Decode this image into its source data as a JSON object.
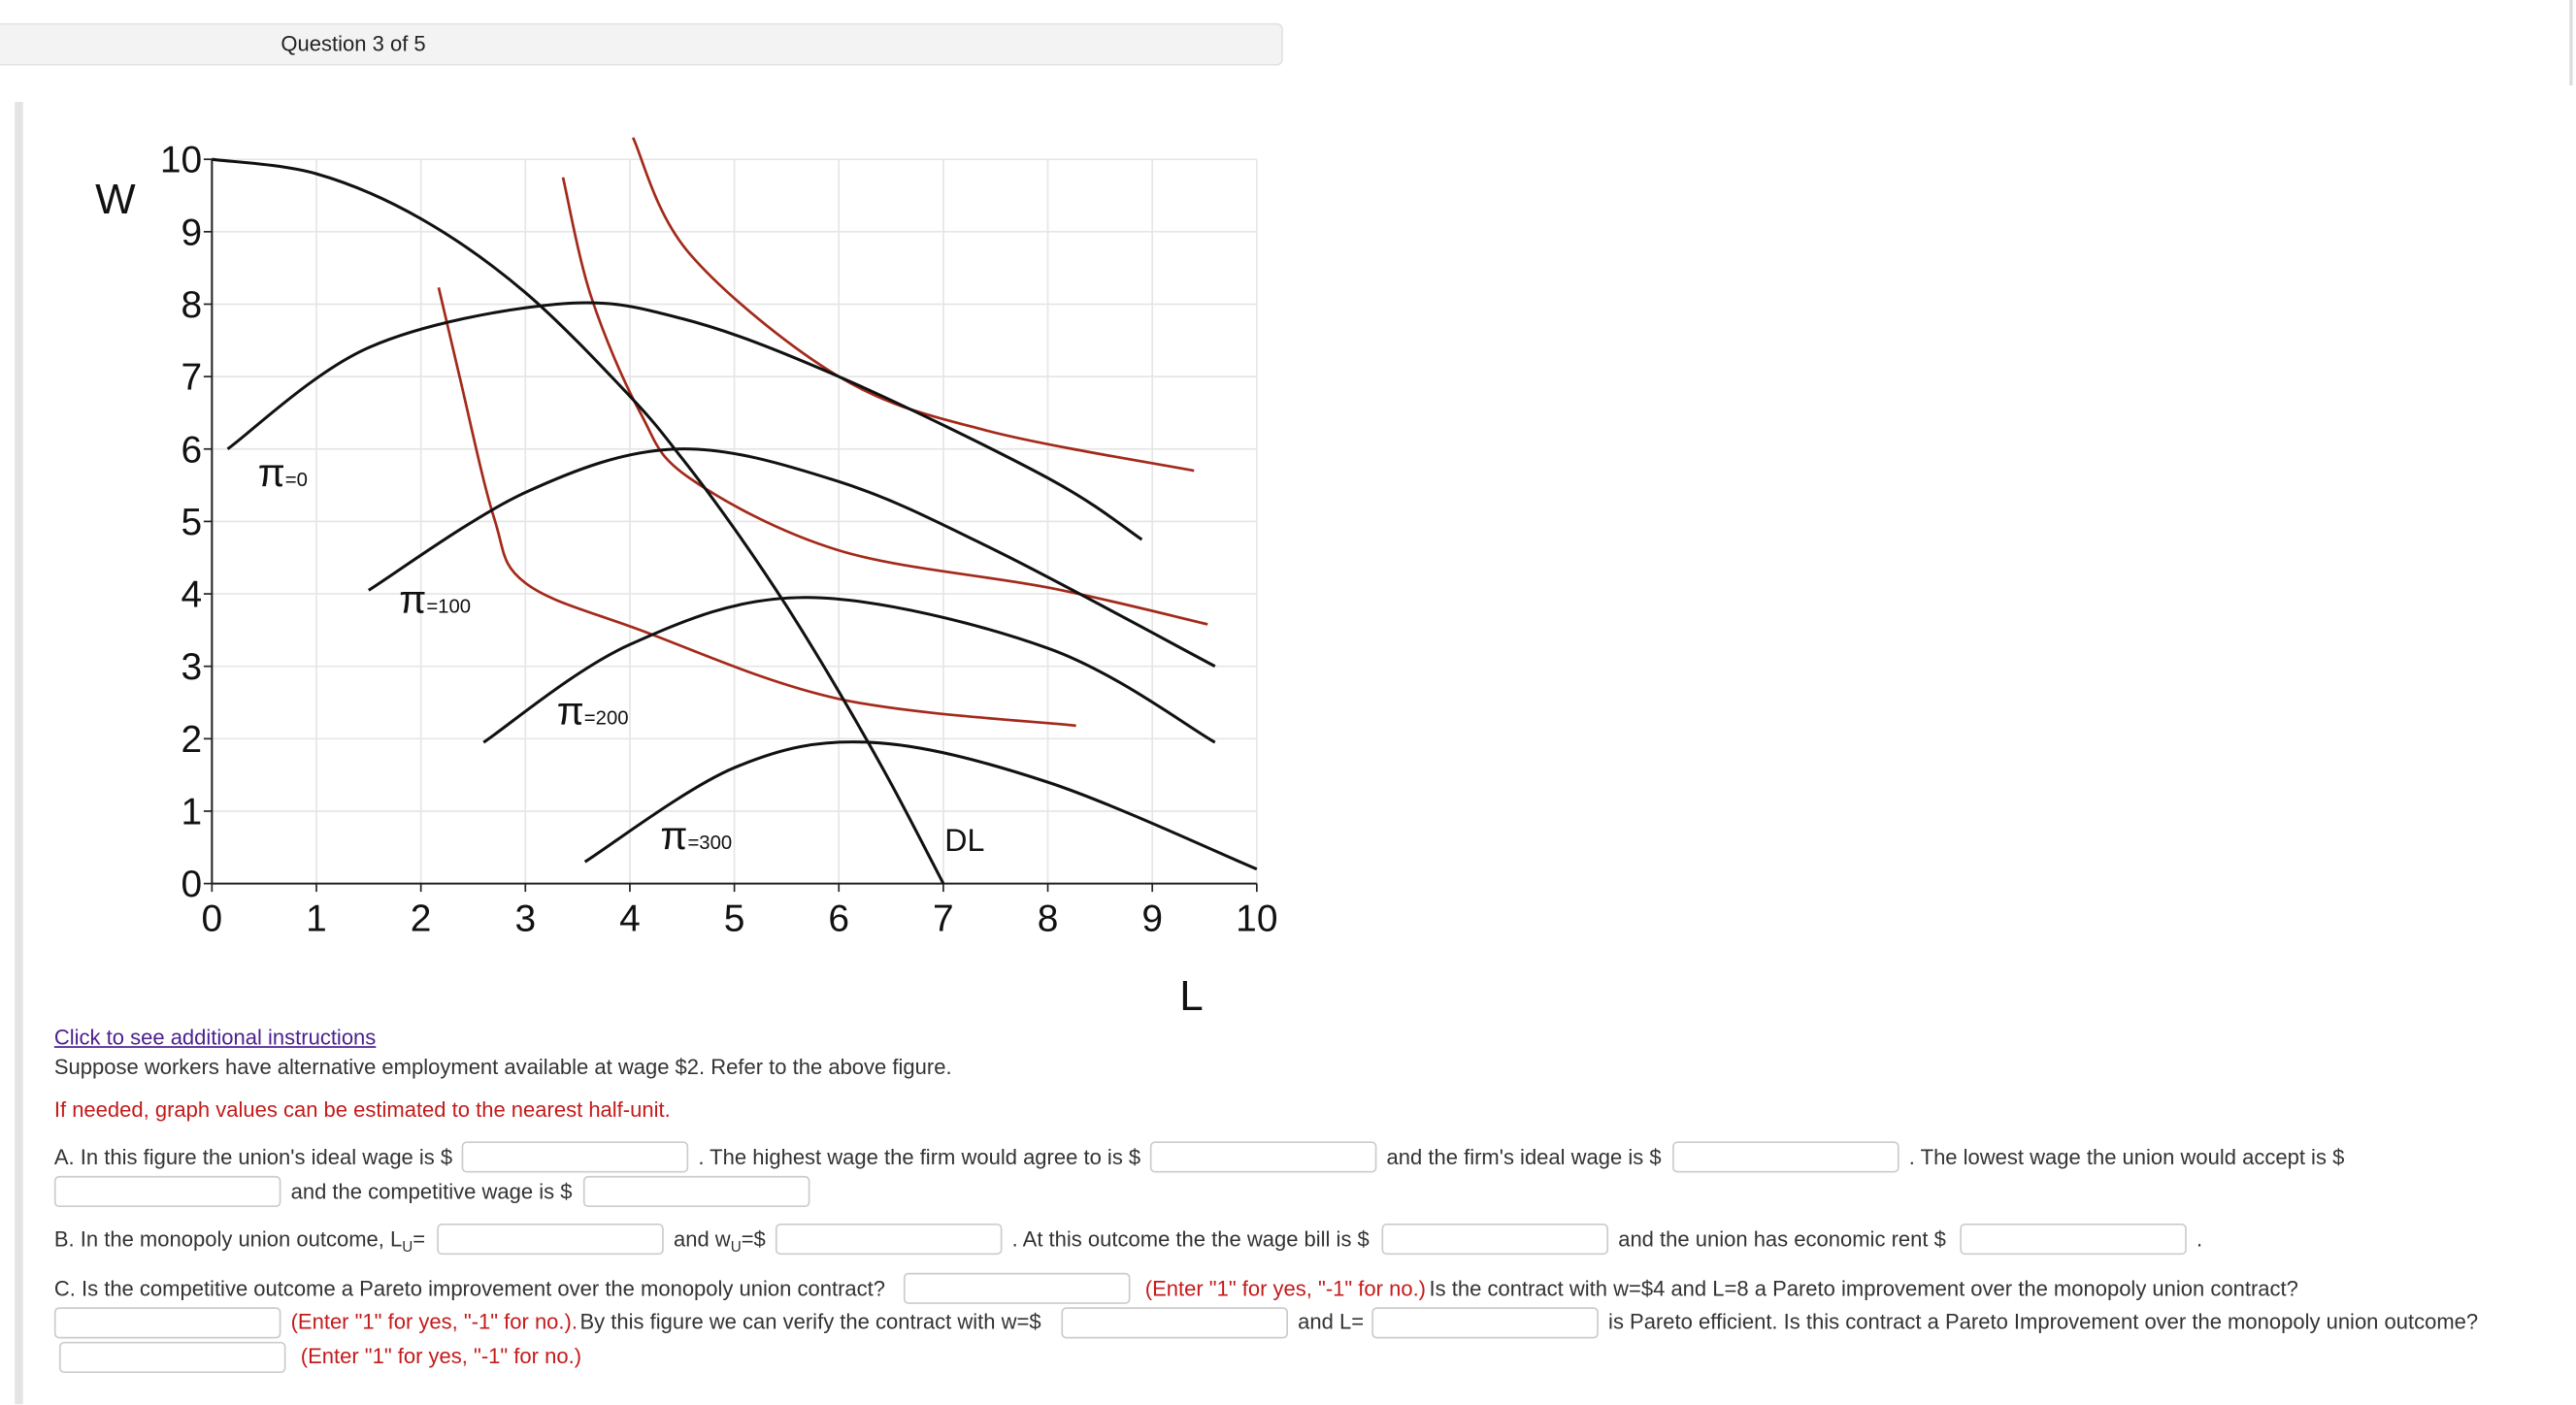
{
  "header": {
    "question_progress": "Question 3 of 5"
  },
  "chart_data": {
    "type": "line",
    "xlabel": "L",
    "ylabel": "W",
    "xlim": [
      0,
      10
    ],
    "ylim": [
      0,
      10
    ],
    "x_ticks": [
      "0",
      "1",
      "2",
      "3",
      "4",
      "5",
      "6",
      "7",
      "8",
      "9",
      "10"
    ],
    "y_ticks": [
      "0",
      "1",
      "2",
      "3",
      "4",
      "5",
      "6",
      "7",
      "8",
      "9",
      "10"
    ],
    "grid": true,
    "colors": {
      "isoprofit": "#111111",
      "indifference": "#a32a1a",
      "demand": "#111111",
      "grid": "#e6e6e6"
    },
    "demand": {
      "label": "DL",
      "points": [
        [
          0,
          10
        ],
        [
          1,
          9.8
        ],
        [
          2,
          9.18
        ],
        [
          3,
          8.16
        ],
        [
          4,
          6.73
        ],
        [
          4.5,
          5.87
        ],
        [
          5,
          4.9
        ],
        [
          5.5,
          3.83
        ],
        [
          6,
          2.65
        ],
        [
          6.5,
          1.38
        ],
        [
          7,
          0
        ]
      ]
    },
    "isoprofit_curves": [
      {
        "label_main": "π",
        "label_sub": "=0",
        "points": [
          [
            0.15,
            6
          ],
          [
            1.5,
            7.4
          ],
          [
            3.3,
            8.0
          ],
          [
            4.5,
            7.8
          ],
          [
            6,
            7.0
          ],
          [
            8,
            5.6
          ],
          [
            8.9,
            4.75
          ]
        ]
      },
      {
        "label_main": "π",
        "label_sub": "=100",
        "points": [
          [
            1.5,
            4.05
          ],
          [
            3,
            5.4
          ],
          [
            4.45,
            6.0
          ],
          [
            6,
            5.55
          ],
          [
            7.5,
            4.6
          ],
          [
            9.6,
            3.0
          ]
        ]
      },
      {
        "label_main": "π",
        "label_sub": "=200",
        "points": [
          [
            2.6,
            1.95
          ],
          [
            4,
            3.3
          ],
          [
            5.7,
            3.95
          ],
          [
            8,
            3.25
          ],
          [
            9.6,
            1.95
          ]
        ]
      },
      {
        "label_main": "π",
        "label_sub": "=300",
        "points": [
          [
            3.57,
            0.3
          ],
          [
            5,
            1.6
          ],
          [
            6.3,
            1.95
          ],
          [
            8,
            1.4
          ],
          [
            10,
            0.2
          ]
        ]
      }
    ],
    "indifference_curves": [
      {
        "points": [
          [
            2.17,
            8.23
          ],
          [
            2.37,
            7.0
          ],
          [
            2.7,
            5.05
          ],
          [
            3,
            4.15
          ],
          [
            4.1,
            3.5
          ],
          [
            6,
            2.55
          ],
          [
            8.27,
            2.18
          ]
        ]
      },
      {
        "points": [
          [
            3.36,
            9.75
          ],
          [
            3.63,
            8.1
          ],
          [
            4.1,
            6.5
          ],
          [
            4.57,
            5.6
          ],
          [
            6,
            4.6
          ],
          [
            8.03,
            4.08
          ],
          [
            9.53,
            3.58
          ]
        ]
      },
      {
        "points": [
          [
            4.03,
            10.3
          ],
          [
            4.57,
            8.7
          ],
          [
            6,
            7.0
          ],
          [
            7.4,
            6.26
          ],
          [
            9.4,
            5.7
          ]
        ]
      }
    ]
  },
  "instructions_link": "Click to see additional instructions",
  "intro": "Suppose workers have alternative employment available at wage $2. Refer to the above figure.",
  "hint": "If needed, graph values can be estimated to the nearest half-unit.",
  "partA": {
    "t1": "A. In this figure the union's ideal wage is $",
    "t2": ". The highest wage the firm would agree to is $",
    "t3": "and the firm's ideal wage is $",
    "t4": ". The lowest wage the union would accept is $",
    "t5": "and the competitive wage is $",
    "inputs": [
      "",
      "",
      "",
      "",
      ""
    ]
  },
  "partB": {
    "t1a": "B. In the monopoly union outcome, L",
    "t1sub": "U",
    "t1b": "=",
    "t2a": "and w",
    "t2sub": "U",
    "t2b": "=$",
    "t3": ". At this outcome the the wage bill is $",
    "t4": "and the union has economic rent $",
    "t5": ".",
    "inputs": [
      "",
      "",
      "",
      ""
    ]
  },
  "partC": {
    "t1": "C. Is the competitive outcome a Pareto improvement over the monopoly union contract?",
    "hint1": "(Enter \"1\" for yes, \"-1\" for no.)",
    "t2": "Is the contract with w=$4 and L=8 a Pareto improvement over the monopoly union contract?",
    "hint2": "(Enter \"1\" for yes, \"-1\" for no.).",
    "t3": "By this figure we can verify the contract with  w=$",
    "t4": "and L=",
    "t5": "is Pareto efficient. Is this contract a Pareto Improvement over the monopoly union outcome?",
    "hint3": "(Enter \"1\" for yes, \"-1\" for no.)",
    "inputs": [
      "",
      "",
      "",
      "",
      ""
    ]
  }
}
